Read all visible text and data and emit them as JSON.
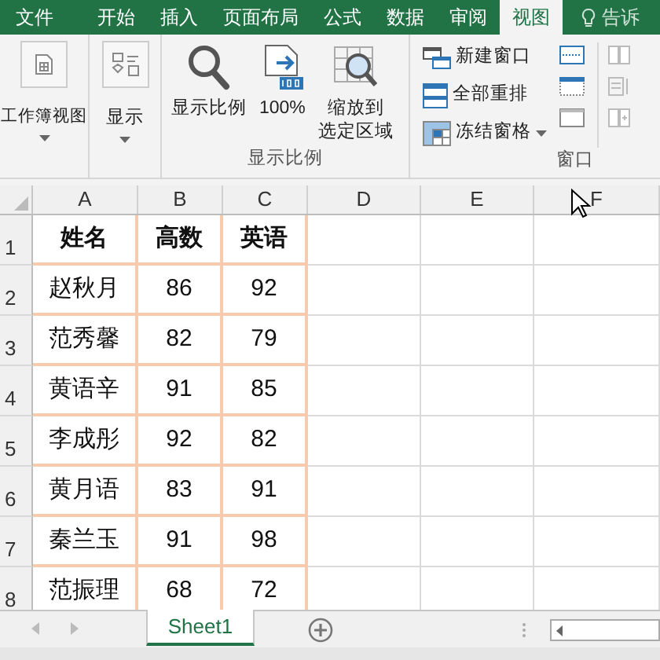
{
  "menu_tabs": [
    {
      "label": "文件",
      "selected": false
    },
    {
      "label": "开始",
      "selected": false
    },
    {
      "label": "插入",
      "selected": false
    },
    {
      "label": "页面布局",
      "selected": false
    },
    {
      "label": "公式",
      "selected": false
    },
    {
      "label": "数据",
      "selected": false
    },
    {
      "label": "审阅",
      "selected": false
    },
    {
      "label": "视图",
      "selected": true
    }
  ],
  "tell_me": "告诉",
  "ribbon": {
    "workbook_views": {
      "label": "工作簿视图"
    },
    "show": {
      "label": "显示"
    },
    "zoom_group": {
      "title": "显示比例",
      "buttons": [
        {
          "kind": "magnifier",
          "lines": [
            "显示比例"
          ]
        },
        {
          "kind": "hundred",
          "lines": [
            "100%"
          ]
        },
        {
          "kind": "zoom-selection",
          "lines": [
            "缩放到",
            "选定区域"
          ]
        }
      ]
    },
    "window_group": {
      "title": "窗口",
      "commands": [
        {
          "kind": "new-window",
          "label": "新建窗口"
        },
        {
          "kind": "arrange",
          "label": "全部重排"
        },
        {
          "kind": "freeze",
          "label": "冻结窗格",
          "dropdown": true
        }
      ]
    }
  },
  "columns": [
    "A",
    "B",
    "C",
    "D",
    "E",
    "F"
  ],
  "table": {
    "header": {
      "number": "1",
      "cells": [
        "姓名",
        "高数",
        "英语"
      ]
    },
    "rows": [
      {
        "number": "2",
        "cells": [
          "赵秋月",
          "86",
          "92"
        ]
      },
      {
        "number": "3",
        "cells": [
          "范秀馨",
          "82",
          "79"
        ]
      },
      {
        "number": "4",
        "cells": [
          "黄语辛",
          "91",
          "85"
        ]
      },
      {
        "number": "5",
        "cells": [
          "李成彤",
          "92",
          "82"
        ]
      },
      {
        "number": "6",
        "cells": [
          "黄月语",
          "83",
          "91"
        ]
      },
      {
        "number": "7",
        "cells": [
          "秦兰玉",
          "91",
          "98"
        ]
      },
      {
        "number": "8",
        "cells": [
          "范振理",
          "68",
          "72"
        ]
      }
    ]
  },
  "sheet_tabs": [
    {
      "label": "Sheet1",
      "selected": true
    }
  ]
}
